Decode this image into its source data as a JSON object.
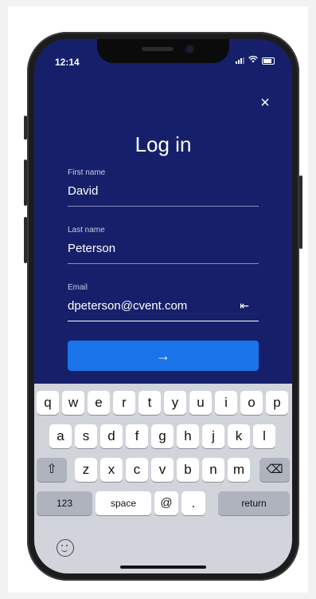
{
  "status_bar": {
    "time": "12:14"
  },
  "screen": {
    "title": "Log in"
  },
  "form": {
    "first_name": {
      "label": "First name",
      "value": "David"
    },
    "last_name": {
      "label": "Last name",
      "value": "Peterson"
    },
    "email": {
      "label": "Email",
      "value": "dpeterson@cvent.com"
    },
    "submit_glyph": "→",
    "clear_glyph": "⇤"
  },
  "close_glyph": "×",
  "keyboard": {
    "row1": [
      "q",
      "w",
      "e",
      "r",
      "t",
      "y",
      "u",
      "i",
      "o",
      "p"
    ],
    "row2": [
      "a",
      "s",
      "d",
      "f",
      "g",
      "h",
      "j",
      "k",
      "l"
    ],
    "row3": [
      "z",
      "x",
      "c",
      "v",
      "b",
      "n",
      "m"
    ],
    "shift_glyph": "⇧",
    "delete_glyph": "⌫",
    "numbers_label": "123",
    "space_label": "space",
    "at_label": "@",
    "dot_label": ".",
    "return_label": "return"
  },
  "colors": {
    "screen_bg": "#16206a",
    "accent": "#1a73e8",
    "keyboard_bg": "#d1d4db"
  }
}
